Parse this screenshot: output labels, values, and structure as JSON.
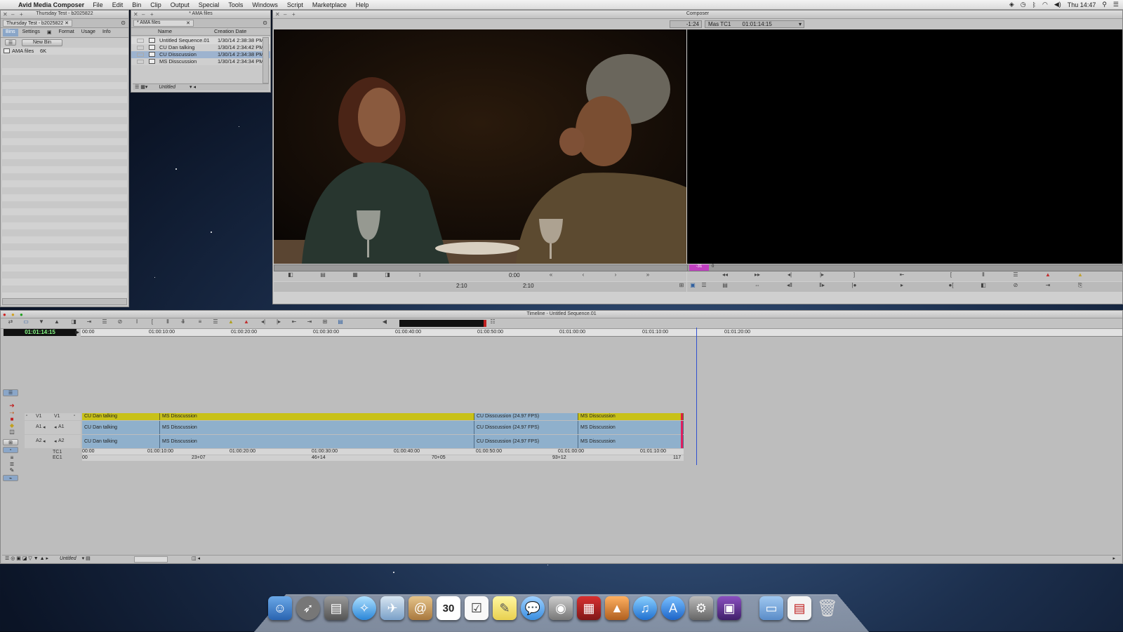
{
  "menubar": {
    "app": "Avid Media Composer",
    "items": [
      "File",
      "Edit",
      "Bin",
      "Clip",
      "Output",
      "Special",
      "Tools",
      "Windows",
      "Script",
      "Marketplace",
      "Help"
    ],
    "clock": "Thu 14:47"
  },
  "project": {
    "title": "Thursday Test - b2025822",
    "tab": "Thursday Test - b2025822",
    "tabs": [
      "Bins",
      "Settings",
      "Format",
      "Usage",
      "Info"
    ],
    "new_bin": "New Bin",
    "bins": [
      {
        "name": "AMA files",
        "size": "6K"
      }
    ]
  },
  "bin": {
    "title": "* AMA files",
    "tab": "* AMA files",
    "col_name": "Name",
    "col_date": "Creation Date",
    "rows": [
      {
        "name": "Untitled Sequence.01",
        "date": "1/30/14 2:38:38 PM"
      },
      {
        "name": "CU Dan talking",
        "date": "1/30/14 2:34:42 PM"
      },
      {
        "name": "CU Disscussion",
        "date": "1/30/14 2:34:38 PM"
      },
      {
        "name": "MS Disscussion",
        "date": "1/30/14 2:34:34 PM"
      }
    ],
    "view": "Untitled"
  },
  "composer": {
    "title": "Composer",
    "tc_offset": "-1:24",
    "tc_label": "Mas TC1",
    "tc_value": "01:01:14:15",
    "source_pos": "0:00",
    "source_dur_left": "2:10",
    "source_dur_right": "2:10",
    "record_marker": "-31",
    "record_pos": "0"
  },
  "timeline": {
    "title": "Timeline - Untitled Sequence.01",
    "current_tc": "01:01:14:15",
    "ruler": [
      "00:00",
      "01:00:10:00",
      "01:00:20:00",
      "01:00:30:00",
      "01:00:40:00",
      "01:00:50:00",
      "01:01:00:00",
      "01:01:10:00",
      "01:01:20:00"
    ],
    "track_labels": {
      "v1": "V1",
      "a1": "A1",
      "a2": "A2",
      "tc1": "TC1",
      "ec1": "EC1"
    },
    "v1_clips": [
      "CU Dan talking",
      "MS Disscussion",
      "CU Disscussion (24.97 FPS)",
      "MS Disscussion"
    ],
    "a1_clips": [
      "CU Dan talking",
      "MS Disscussion",
      "CU Disscussion (24.97 FPS)",
      "MS Disscussion"
    ],
    "a2_clips": [
      "CU Dan talking",
      "MS Disscussion",
      "CU Disscussion (24.97 FPS)",
      "MS Disscussion"
    ],
    "tc_ruler": [
      "00:00",
      "01:00:10:00",
      "01:00:20:00",
      "01:00:30:00",
      "01:00:40:00",
      "01:00:50:00",
      "01:01:00:00",
      "01:01:10:00"
    ],
    "ec_ruler": [
      "00",
      "23+07",
      "46+14",
      "70+05",
      "93+12",
      "117"
    ],
    "footer_view": "Untitled"
  },
  "dock": [
    "finder-icon",
    "launchpad-icon",
    "preview-icon",
    "safari-icon",
    "mail-bird-icon",
    "contacts-icon",
    "calendar-icon",
    "reminders-icon",
    "notes-icon",
    "messages-icon",
    "facetime-icon",
    "photobooth-icon",
    "iphoto-icon",
    "itunes-icon",
    "appstore-icon",
    "system-preferences-icon",
    "avid-icon",
    "folder-icon",
    "document-icon",
    "trash-icon"
  ],
  "calendar_day": "30",
  "colors": {
    "video_track": "#c8c118",
    "audio_track": "#8fb0cc",
    "panel": "#c9c9c9"
  }
}
